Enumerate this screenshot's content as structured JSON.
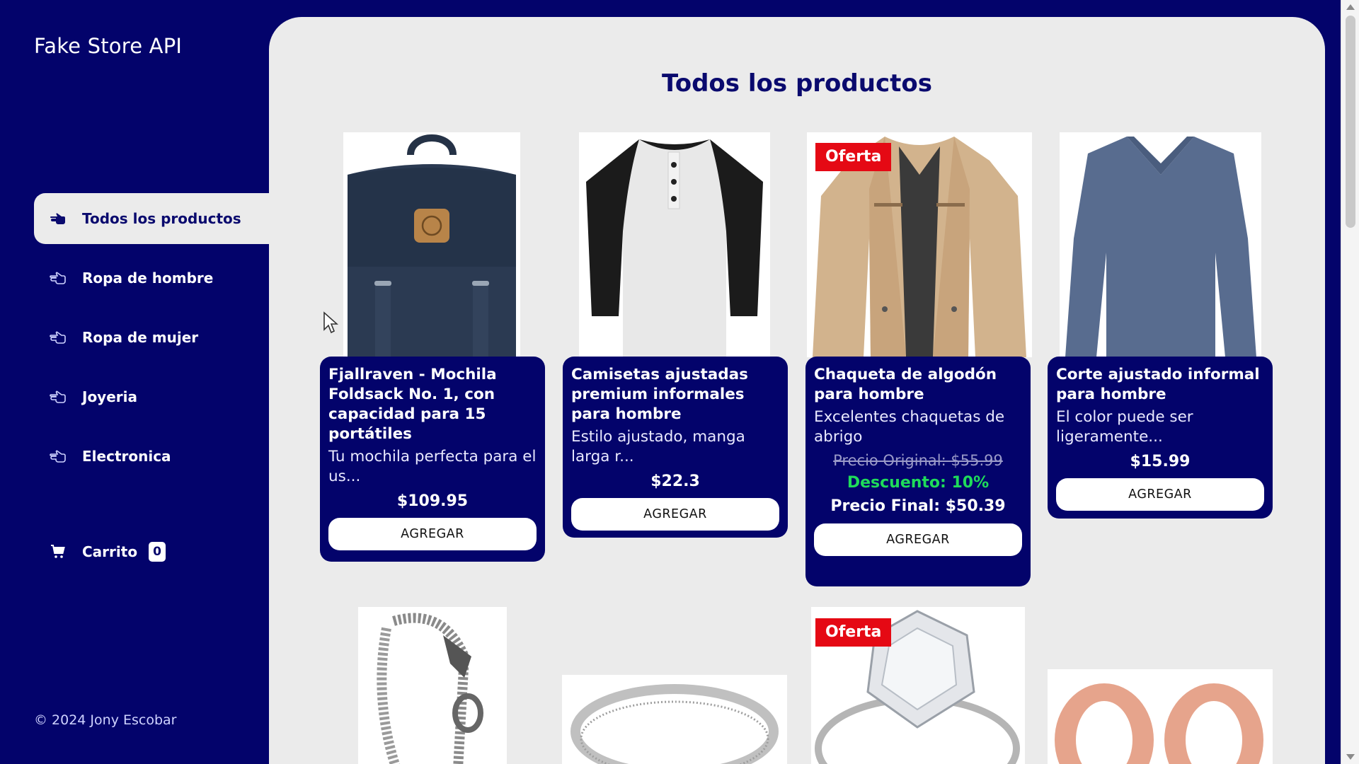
{
  "sidebar": {
    "brand": "Fake Store API",
    "items": [
      {
        "label": "Todos los productos",
        "icon": "pointing-hand-icon",
        "active": true
      },
      {
        "label": "Ropa de hombre",
        "icon": "pointing-hand-outline-icon"
      },
      {
        "label": "Ropa de mujer",
        "icon": "pointing-hand-outline-icon"
      },
      {
        "label": "Joyeria",
        "icon": "pointing-hand-outline-icon"
      },
      {
        "label": "Electronica",
        "icon": "pointing-hand-outline-icon"
      }
    ],
    "cart": {
      "label": "Carrito",
      "count": "0",
      "icon": "cart-icon"
    },
    "footer": "© 2024 Jony Escobar"
  },
  "main": {
    "title": "Todos los productos",
    "products": [
      {
        "name": "Fjallraven - Mochila Foldsack No. 1, con capacidad para 15 portátiles",
        "description": "Tu mochila perfecta para el us...",
        "price": "$109.95",
        "button": "AGREGAR",
        "image": "backpack"
      },
      {
        "name": "Camisetas ajustadas premium informales para hombre",
        "description": "Estilo ajustado, manga larga r...",
        "price": "$22.3",
        "button": "AGREGAR",
        "image": "raglan-tshirt"
      },
      {
        "name": "Chaqueta de algodón para hombre",
        "description": "Excelentes chaquetas de abrigo",
        "badge": "Oferta",
        "original_price": "Precio Original: $55.99",
        "discount": "Descuento: 10%",
        "final_price": "Precio Final: $50.39",
        "button": "AGREGAR",
        "image": "cotton-jacket"
      },
      {
        "name": "Corte ajustado informal para hombre",
        "description": "El color puede ser ligeramente...",
        "price": "$15.99",
        "button": "AGREGAR",
        "image": "long-sleeve-shirt"
      }
    ],
    "second_row": [
      {
        "image": "dragon-chain-bracelet"
      },
      {
        "image": "silver-ring"
      },
      {
        "image": "diamond-ring",
        "badge": "Oferta"
      },
      {
        "image": "rose-gold-plugs"
      }
    ]
  },
  "colors": {
    "navy": "#03036b",
    "panel": "#ebebeb",
    "offer_red": "#e50914",
    "discount_green": "#1fdc5a"
  }
}
